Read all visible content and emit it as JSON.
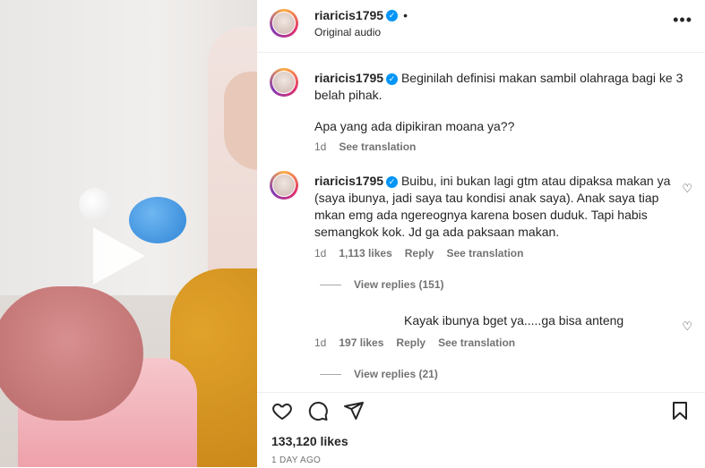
{
  "header": {
    "username": "riaricis1795",
    "verified_mark": "✓",
    "separator": "•",
    "audio": "Original audio",
    "more": "•••"
  },
  "caption": {
    "username": "riaricis1795",
    "text_line1": "Beginilah definisi makan sambil olahraga bagi ke 3",
    "text_line2": "belah pihak.",
    "text_line3": "Apa yang ada dipikiran moana ya??",
    "time": "1d",
    "see_translation": "See translation"
  },
  "comments": [
    {
      "username": "riaricis1795",
      "lines": [
        "Buibu, ini bukan lagi gtm atau dipaksa makan ya",
        "(saya ibunya, jadi saya tau kondisi anak saya). Anak saya tiap",
        "mkan emg ada ngereognya karena bosen duduk. Tapi habis",
        "semangkok kok. Jd ga ada paksaan makan."
      ],
      "time": "1d",
      "likes": "1,113 likes",
      "reply": "Reply",
      "see_translation": "See translation",
      "view_replies": "View replies (151)"
    },
    {
      "username": "",
      "lines": [
        "Kayak ibunya bget ya.....ga bisa anteng"
      ],
      "time": "1d",
      "likes": "197 likes",
      "reply": "Reply",
      "see_translation": "See translation",
      "view_replies": "View replies (21)"
    }
  ],
  "footer": {
    "likes": "133,120 likes",
    "time": "1 DAY AGO"
  },
  "icons": [
    "heart-icon",
    "comment-icon",
    "share-icon",
    "bookmark-icon",
    "play-icon",
    "more-icon"
  ],
  "colors": {
    "verified": "#0095f6",
    "meta": "#737373",
    "text": "#262626"
  }
}
